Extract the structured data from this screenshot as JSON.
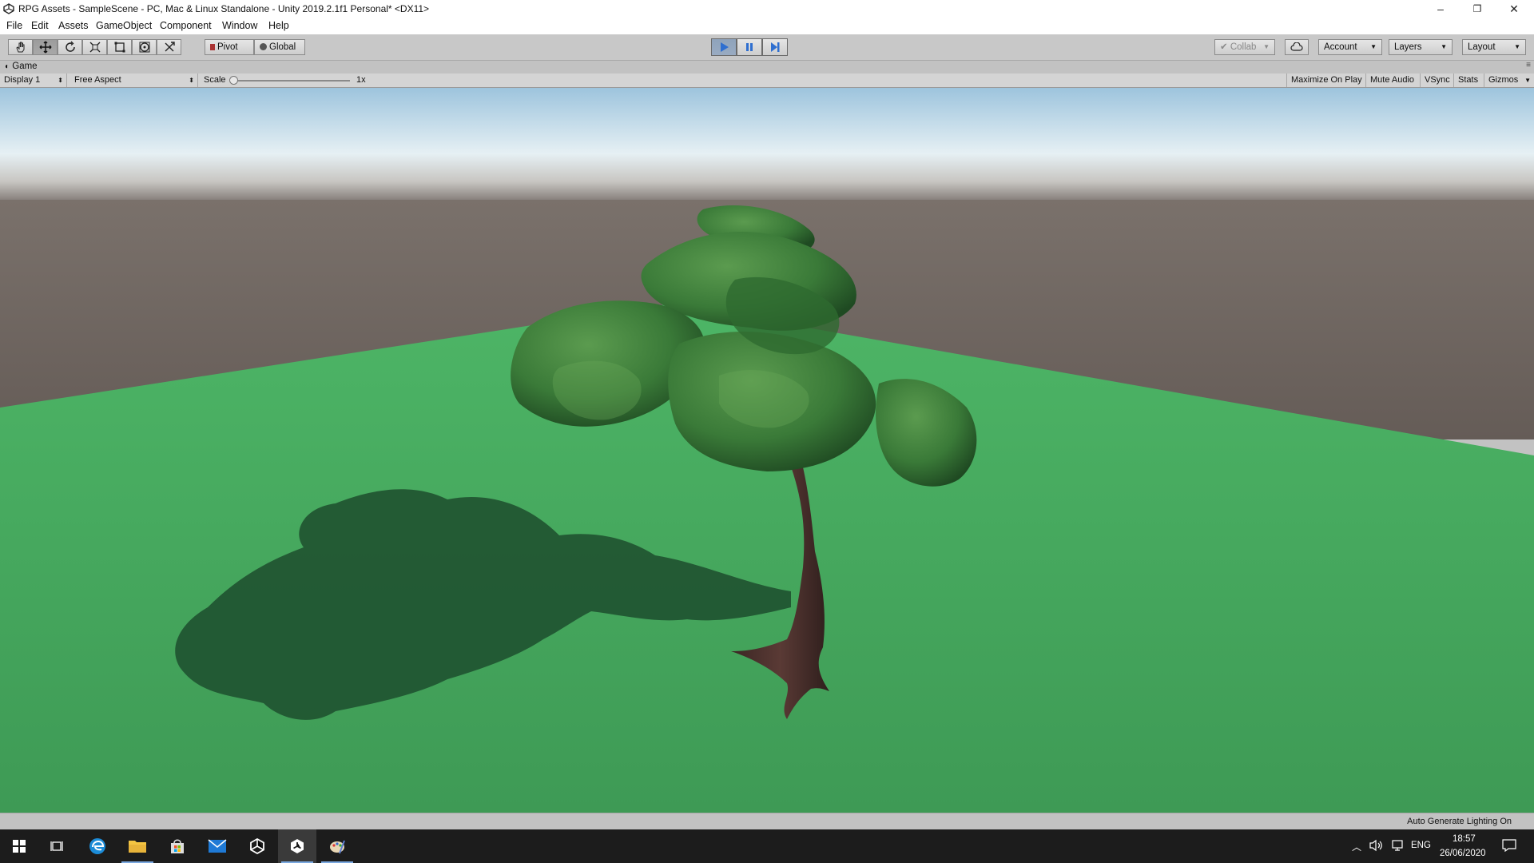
{
  "window": {
    "title": "RPG Assets - SampleScene - PC, Mac & Linux Standalone - Unity 2019.2.1f1 Personal* <DX11>",
    "controls": [
      "–",
      "❐",
      "✕"
    ]
  },
  "menu": [
    "File",
    "Edit",
    "Assets",
    "GameObject",
    "Component",
    "Window",
    "Help"
  ],
  "toolbar": {
    "tools": [
      "hand-tool-icon",
      "move-tool-icon",
      "rotate-tool-icon",
      "scale-tool-icon",
      "rect-tool-icon",
      "transform-tool-icon",
      "custom-tool-icon"
    ],
    "pivot_label": "Pivot",
    "global_label": "Global",
    "collab_label": "Collab",
    "account_label": "Account",
    "layers_label": "Layers",
    "layout_label": "Layout",
    "play_state": "playing"
  },
  "game_view": {
    "tab_label": "Game",
    "display_label": "Display 1",
    "aspect_label": "Free Aspect",
    "scale_label": "Scale",
    "scale_value": "1x",
    "options": [
      "Maximize On Play",
      "Mute Audio",
      "VSync",
      "Stats",
      "Gizmos"
    ]
  },
  "status_bar": {
    "text": "Auto Generate Lighting On"
  },
  "taskbar": {
    "icons": [
      "windows-start-icon",
      "task-view-icon",
      "edge-browser-icon",
      "file-explorer-icon",
      "store-icon",
      "mail-icon",
      "unity-hub-icon",
      "unity-editor-icon",
      "paint-icon"
    ],
    "language": "ENG",
    "time": "18:57",
    "date": "26/06/2020"
  },
  "colors": {
    "play_accent": "#2f6fd0",
    "ground": "#47a35c",
    "horizon": "#6b625c",
    "foliage": "#2f6a2e",
    "trunk": "#4a2f2a"
  }
}
